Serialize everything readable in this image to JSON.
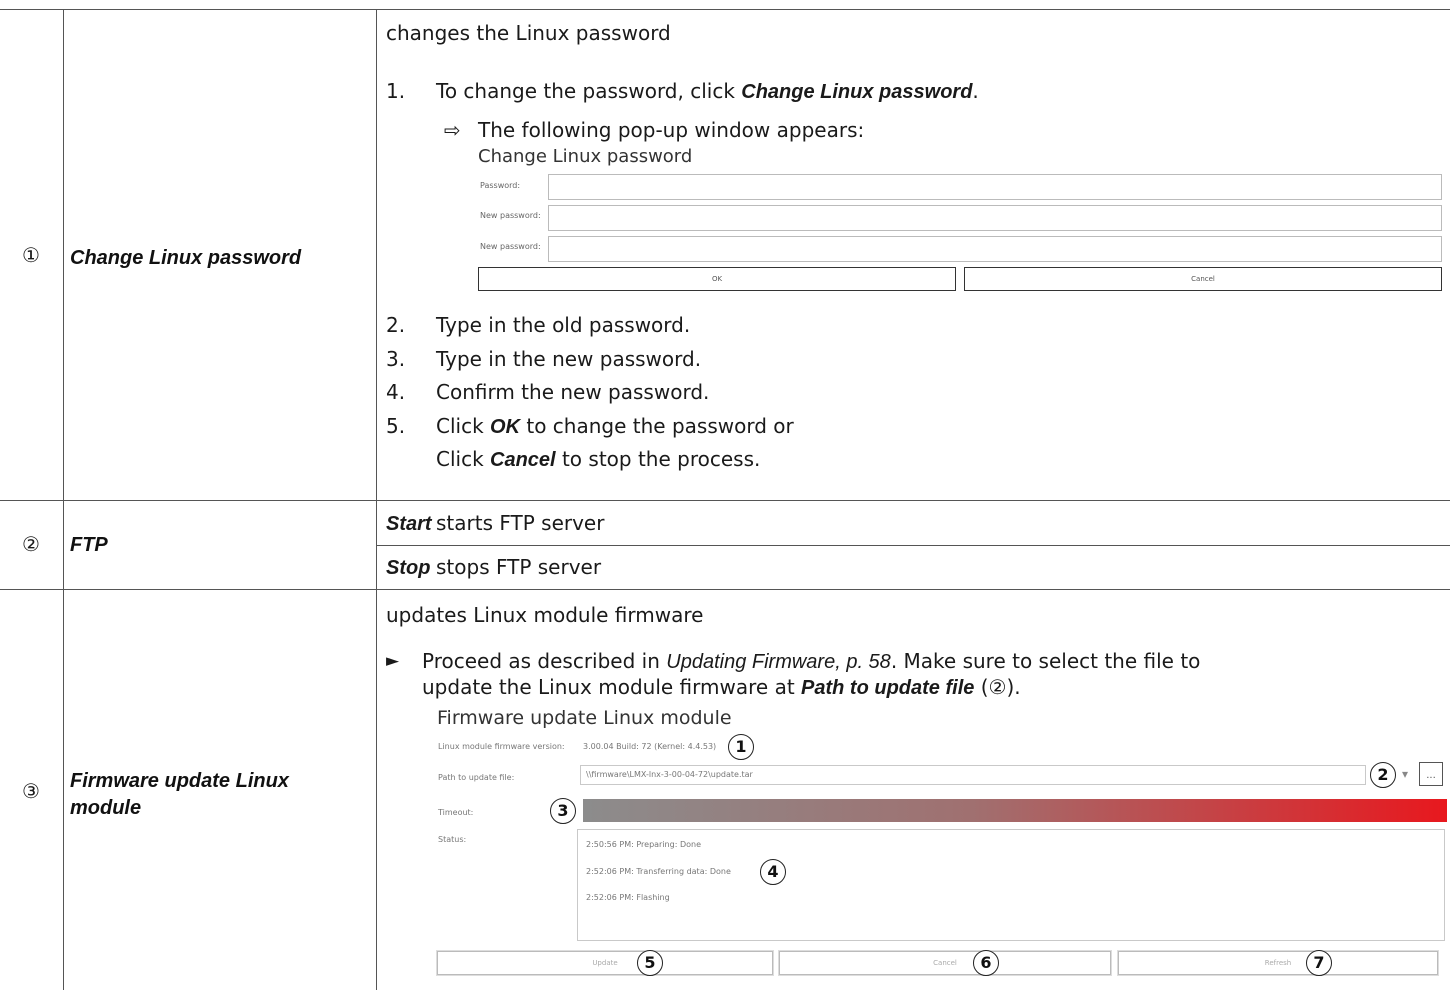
{
  "rows": [
    {
      "num": "①",
      "label": "Change Linux password",
      "intro": "changes the Linux password",
      "steps": [
        {
          "n": "1.",
          "pre": "To change the password, click ",
          "em": "Change Linux password",
          "post": "."
        },
        {
          "n": "2.",
          "text": "Type in the old password."
        },
        {
          "n": "3.",
          "text": "Type in the new password."
        },
        {
          "n": "4.",
          "text": "Confirm the new password."
        },
        {
          "n": "5.",
          "pre": "Click ",
          "em": "OK",
          "post": " to change the password or"
        },
        {
          "n": "",
          "pre": "Click ",
          "em": "Cancel",
          "post": " to stop the process."
        }
      ],
      "result_arrow": "⇨",
      "result": "The following pop-up window appears:",
      "dialog": {
        "title": "Change Linux password",
        "fields": [
          "Password:",
          "New password:",
          "New password:"
        ],
        "ok": "OK",
        "cancel": "Cancel"
      }
    },
    {
      "num": "②",
      "label": "FTP",
      "sub": [
        {
          "key": "Start",
          "text": "starts FTP server"
        },
        {
          "key": "Stop",
          "text": "stops FTP server"
        }
      ]
    },
    {
      "num": "③",
      "label_lines": [
        "Firmware update Linux",
        "module"
      ],
      "intro": "updates Linux module firmware",
      "bullet": "►",
      "proc_pre": "Proceed as described in ",
      "proc_ref": "Updating Firmware, p. 58",
      "proc_mid": ". Make sure to select the file to",
      "proc2_pre": "update the Linux module firmware at ",
      "proc2_em": "Path to update file",
      "proc2_post": " (②).",
      "dialog": {
        "title": "Firmware update Linux module",
        "version_label": "Linux module firmware version:",
        "version_value": "3.00.04 Build: 72 (Kernel: 4.4.53)",
        "path_label": "Path to update file:",
        "path_value": "\\\\firmware\\LMX-lnx-3-00-04-72\\update.tar",
        "browse": "...",
        "dropdown": "▾",
        "timeout_label": "Timeout:",
        "status_label": "Status:",
        "status_lines": [
          "2:50:56 PM: Preparing: Done",
          "2:52:06 PM: Transferring data: Done",
          "2:52:06 PM: Flashing"
        ],
        "buttons": [
          "Update",
          "Cancel",
          "Refresh"
        ],
        "progress_colors": {
          "start": "#8c8c8c",
          "end": "#e8181e"
        },
        "markers": [
          "1",
          "2",
          "3",
          "4",
          "5",
          "6",
          "7"
        ]
      }
    }
  ]
}
